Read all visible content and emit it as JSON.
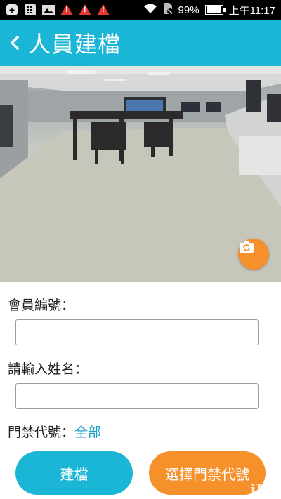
{
  "status_bar": {
    "battery": "99%",
    "time": "上午11:17",
    "battery_level": 0.99
  },
  "app_bar": {
    "title": "人員建檔",
    "back_icon": "chevron-left-icon"
  },
  "camera": {
    "switch_icon": "camera-switch-icon"
  },
  "form": {
    "member_no_label": "會員編號：",
    "member_no_value": "",
    "name_label": "請輸入姓名：",
    "name_value": "",
    "door_code_label": "門禁代號：",
    "door_code_value": "全部"
  },
  "buttons": {
    "create_label": "建檔",
    "select_door_label": "選擇門禁代號"
  },
  "watermark": "iBT",
  "colors": {
    "primary": "#1bb6d6",
    "accent": "#f5902a",
    "link": "#1aa0c3"
  }
}
